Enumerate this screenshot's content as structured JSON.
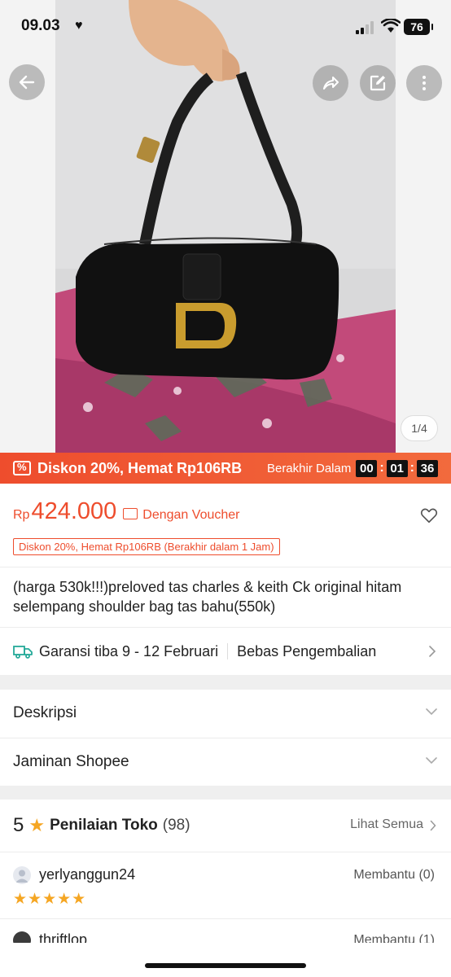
{
  "status_bar": {
    "time": "09.03",
    "battery": "76"
  },
  "image_gallery": {
    "counter": "1/4"
  },
  "promo_bar": {
    "text": "Diskon 20%, Hemat Rp106RB",
    "ends_label": "Berakhir Dalam",
    "timer": {
      "hours": "00",
      "minutes": "01",
      "seconds": "36"
    }
  },
  "price": {
    "currency": "Rp",
    "amount": "424.000",
    "voucher_label": "Dengan Voucher",
    "discount_tag": "Diskon 20%, Hemat Rp106RB (Berakhir dalam 1 Jam)"
  },
  "product": {
    "title": "(harga 530k!!!)preloved tas charles & keith Ck original hitam selempang shoulder bag tas bahu(550k)"
  },
  "shipping": {
    "guarantee": "Garansi tiba 9 - 12 Februari",
    "returns": "Bebas Pengembalian"
  },
  "sections": [
    {
      "label": "Deskripsi"
    },
    {
      "label": "Jaminan Shopee"
    }
  ],
  "shop_rating": {
    "score": "5",
    "label": "Penilaian Toko",
    "count": "(98)",
    "see_all": "Lihat Semua"
  },
  "reviews": [
    {
      "username": "yerlyanggun24",
      "helpful": "Membantu (0)",
      "stars": "★★★★★"
    },
    {
      "username": "thriftlop",
      "helpful": "Membantu (1)"
    }
  ],
  "colors": {
    "accent": "#ee4d2d",
    "star": "#f5a623"
  }
}
